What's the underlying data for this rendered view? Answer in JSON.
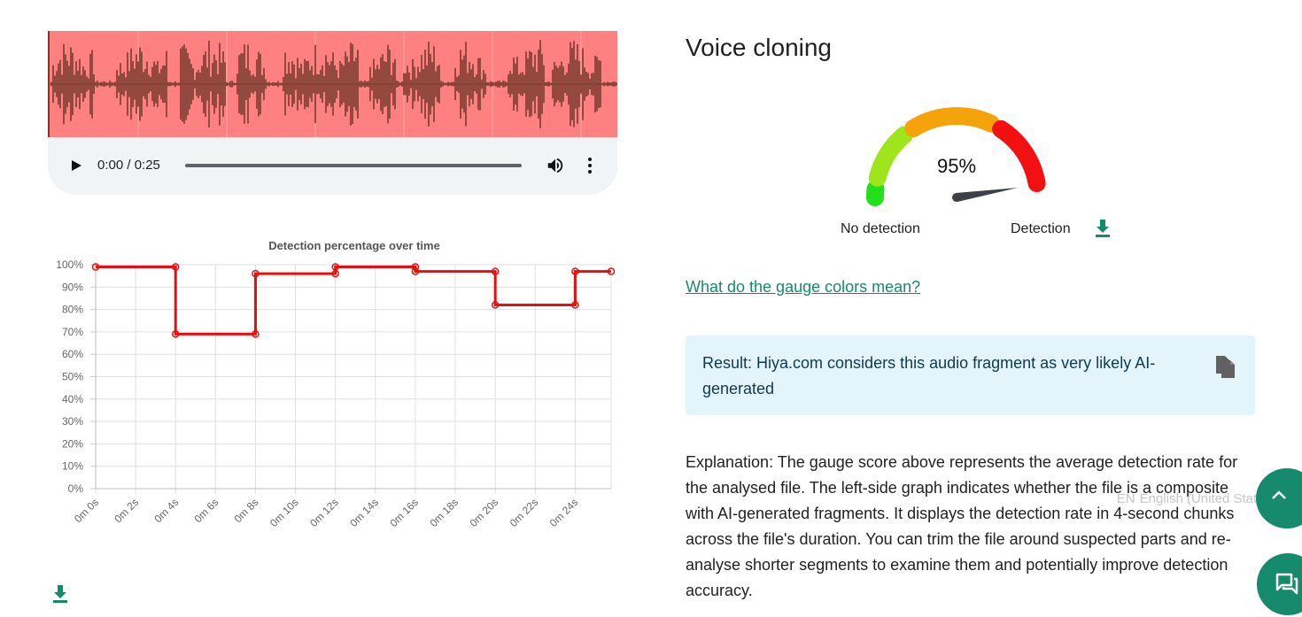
{
  "audio": {
    "time_display": "0:00 / 0:25"
  },
  "chart_data": {
    "type": "line",
    "step": true,
    "title": "Detection percentage over time",
    "categories": [
      "0m 0s",
      "0m 2s",
      "0m 4s",
      "0m 6s",
      "0m 8s",
      "0m 10s",
      "0m 12s",
      "0m 14s",
      "0m 16s",
      "0m 18s",
      "0m 20s",
      "0m 22s",
      "0m 24s"
    ],
    "x_max_seconds": 25.8,
    "series": [
      {
        "color": "#e80e0e",
        "points": [
          {
            "x": 0,
            "y": 99
          },
          {
            "x": 4,
            "y": 99
          },
          {
            "x": 4,
            "y": 69
          },
          {
            "x": 8,
            "y": 69
          },
          {
            "x": 8,
            "y": 96
          },
          {
            "x": 12,
            "y": 96
          },
          {
            "x": 12,
            "y": 99
          },
          {
            "x": 16,
            "y": 99
          },
          {
            "x": 16,
            "y": 97
          },
          {
            "x": 20,
            "y": 97
          },
          {
            "x": 20,
            "y": 82
          },
          {
            "x": 24,
            "y": 82
          },
          {
            "x": 24,
            "y": 97
          },
          {
            "x": 25.8,
            "y": 97
          }
        ]
      }
    ],
    "ylim": [
      0,
      100
    ],
    "yticks": [
      "0%",
      "10%",
      "20%",
      "30%",
      "40%",
      "50%",
      "60%",
      "70%",
      "80%",
      "90%",
      "100%"
    ],
    "grid": true
  },
  "result": {
    "heading": "Voice cloning",
    "gauge_value": "95%",
    "gauge_percent": 95,
    "gauge_min_label": "No detection",
    "gauge_max_label": "Detection",
    "gauge_colors": [
      "#22e01b",
      "#9ee61b",
      "#f5a30a",
      "#f21010"
    ],
    "help_link": "What do the gauge colors mean?",
    "summary": "Result: Hiya.com considers this audio fragment as very likely AI-generated",
    "explanation": "Explanation: The gauge score above represents the average detection rate for the analysed file. The left-side graph indicates whether the file is a composite with AI-generated fragments. It displays the detection rate in 4-second chunks across the file's duration. You can trim the file around suspected parts and re-analyse shorter segments to examine them and potentially improve detection accuracy."
  },
  "language": {
    "code": "EN",
    "name": "English (United States)"
  },
  "colors": {
    "accent": "#168a6c",
    "waveform_bg": "#ff8080",
    "waveform_fg": "#7a3b2e"
  },
  "icons": {
    "play": "play-icon",
    "volume": "volume-icon",
    "more": "more-vert-icon",
    "download": "download-icon",
    "copy": "copy-icon",
    "chevron_up": "chevron-up-icon",
    "chat": "chat-icon"
  }
}
